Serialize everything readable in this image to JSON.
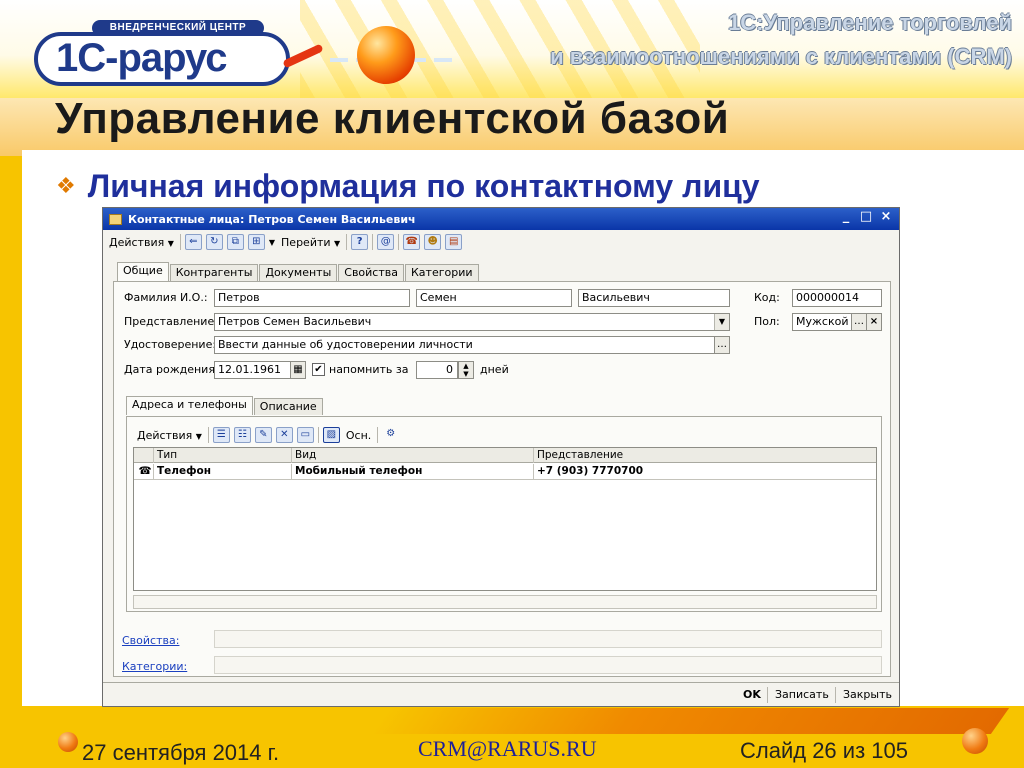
{
  "slide": {
    "logo_badge": "ВНЕДРЕНЧЕСКИЙ ЦЕНТР",
    "logo_text": "1С-рарус",
    "product_line1": "1С:Управление торговлей",
    "product_line2": "и взаимоотношениями с клиентами (CRM)",
    "title": "Управление клиентской базой",
    "bullet_icon": "diamond-bullet-icon",
    "subtitle": "Личная информация по контактному лицу",
    "footer_date": "27 сентября 2014 г.",
    "footer_email": "CRM@RARUS.RU",
    "footer_slide": "Слайд 26 из  105"
  },
  "window": {
    "title": "Контактные лица: Петров Семен Васильевич",
    "controls": [
      "_",
      "□",
      "×"
    ],
    "toolbar": {
      "actions_label": "Действия",
      "goto_label": "Перейти",
      "icons": [
        "back-arrow-icon",
        "refresh-icon",
        "copy-icon",
        "hierarchy-icon",
        "help-icon",
        "email-icon",
        "phone-icon",
        "contacts-icon",
        "fax-icon"
      ]
    },
    "tabs": [
      "Общие",
      "Контрагенты",
      "Документы",
      "Свойства",
      "Категории"
    ],
    "fields": {
      "fio_label": "Фамилия И.О.:",
      "last_name": "Петров",
      "first_name": "Семен",
      "middle_name": "Васильевич",
      "code_label": "Код:",
      "code": "000000014",
      "repr_label": "Представление:",
      "repr": "Петров Семен Васильевич",
      "gender_label": "Пол:",
      "gender": "Мужской",
      "id_label": "Удостоверение:",
      "id_value": "Ввести данные об удостоверении личности",
      "birth_label": "Дата рождения:",
      "birth_date": "12.01.1961",
      "remind_label": "напомнить за",
      "remind_days": "0",
      "days_label": "дней"
    },
    "inner_tabs": [
      "Адреса и телефоны",
      "Описание"
    ],
    "inner_toolbar": {
      "actions_label": "Действия",
      "main_label": "Осн."
    },
    "grid": {
      "columns": [
        "Тип",
        "Вид",
        "Представление"
      ],
      "rows": [
        {
          "type": "Телефон",
          "kind": "Мобильный телефон",
          "repr": "+7 (903) 7770700"
        }
      ]
    },
    "links": {
      "properties": "Свойства:",
      "categories": "Категории:"
    },
    "buttons": {
      "ok": "OK",
      "save": "Записать",
      "close": "Закрыть"
    }
  },
  "colors": {
    "slide_yellow": "#f7c400",
    "title_bar_blue": "#0a35a8",
    "subtitle_blue": "#1f2f9c",
    "bullet_orange": "#e07a00"
  }
}
